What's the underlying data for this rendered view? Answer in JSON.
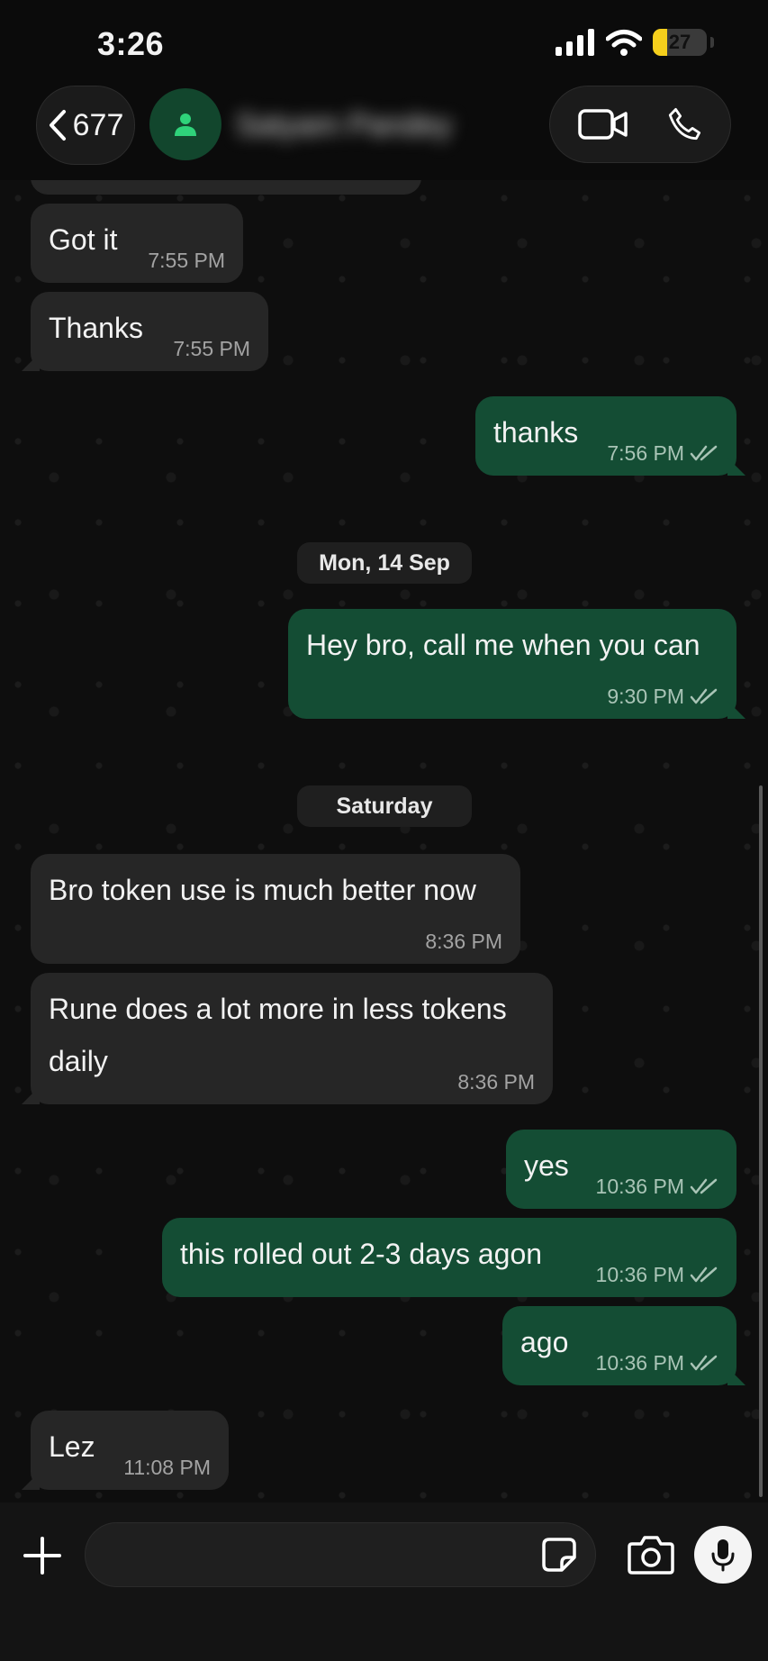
{
  "status_bar": {
    "time": "3:26",
    "battery": "27",
    "battery_level": 0.27
  },
  "header": {
    "back_count": "677",
    "contact_name": "Satyam Pandey",
    "icons": [
      "back-chevron-icon",
      "person-icon",
      "video-call-icon",
      "phone-icon"
    ]
  },
  "messages": [
    {
      "dir": "in",
      "text": "Got it",
      "time": "7:55 PM"
    },
    {
      "dir": "in",
      "text": "Thanks",
      "time": "7:55 PM"
    },
    {
      "dir": "out",
      "text": "thanks",
      "time": "7:56 PM",
      "read": true
    },
    {
      "dir": "out",
      "text": "Hey bro, call me when you can",
      "time": "9:30 PM",
      "read": true
    },
    {
      "dir": "in",
      "text": "Bro token use is much better now",
      "time": "8:36 PM"
    },
    {
      "dir": "in",
      "text_line1": "Rune does a lot more in less tokens",
      "text_line2": "daily",
      "time": "8:36 PM"
    },
    {
      "dir": "out",
      "text": "yes",
      "time": "10:36 PM",
      "read": true
    },
    {
      "dir": "out",
      "text": "this rolled out 2-3 days agon",
      "time": "10:36 PM",
      "read": true
    },
    {
      "dir": "out",
      "text": "ago",
      "time": "10:36 PM",
      "read": true
    },
    {
      "dir": "in",
      "text": "Lez",
      "time": "11:08 PM"
    }
  ],
  "date_separators": [
    "Mon, 14 Sep",
    "Saturday"
  ],
  "composer": {
    "value": "",
    "icons": [
      "plus-icon",
      "sticker-icon",
      "camera-icon",
      "mic-icon"
    ]
  },
  "colors": {
    "background": "#0b0b0b",
    "incoming_bubble": "#262626",
    "outgoing_bubble": "#144d34",
    "read_ticks": "#a9c4b6",
    "battery": "#f5cf1c",
    "avatar": "#12462d"
  }
}
